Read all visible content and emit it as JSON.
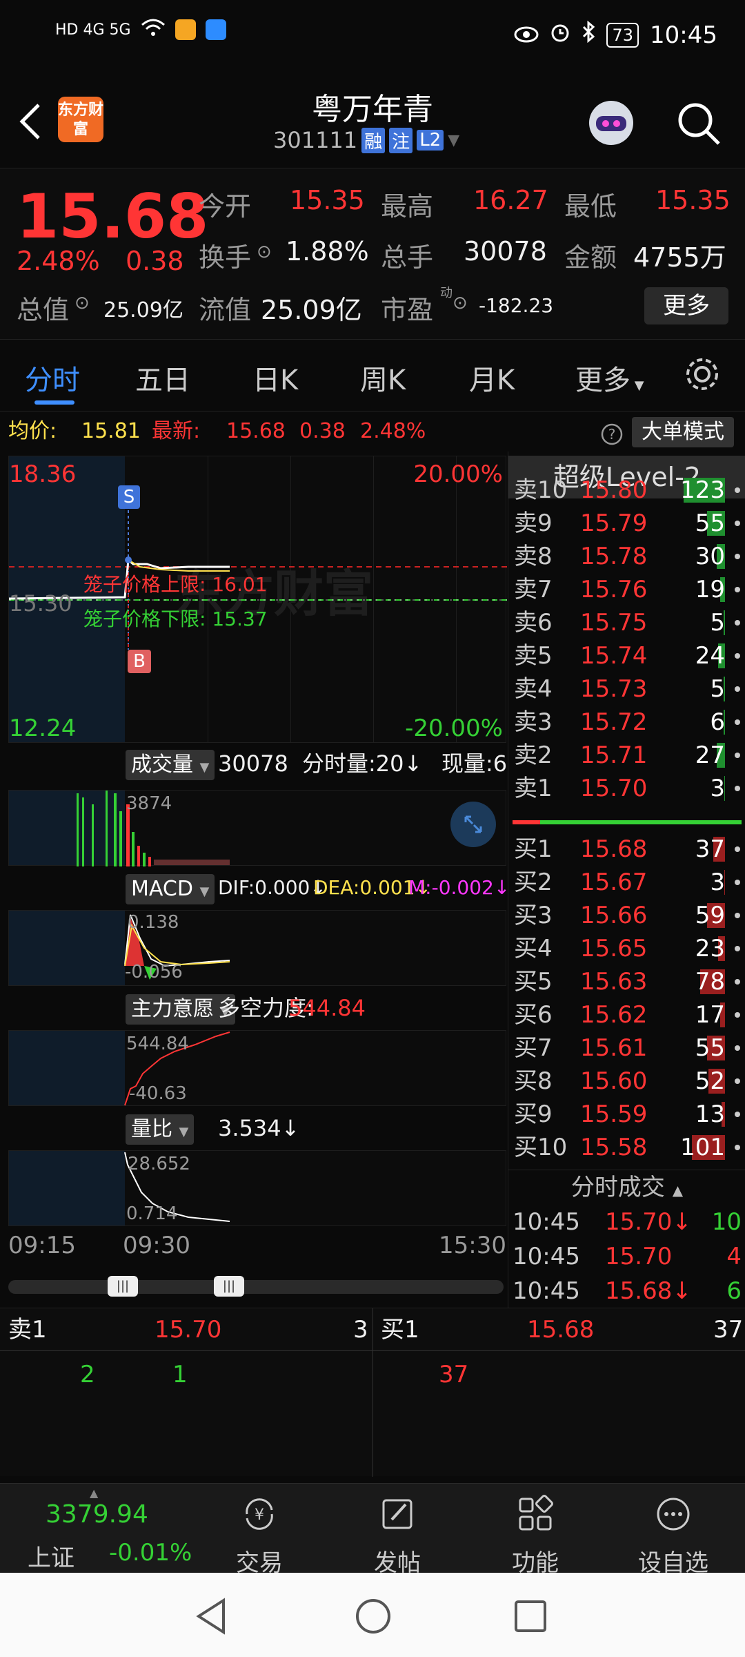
{
  "status_bar": {
    "network": "HD 4G 5G",
    "battery": "73",
    "time": "10:45"
  },
  "header": {
    "logo_text": "东方财富",
    "title": "粤万年青",
    "code": "301111",
    "tags": [
      "融",
      "注",
      "L2"
    ]
  },
  "quote": {
    "price": "15.68",
    "change_pct": "2.48%",
    "change": "0.38",
    "open_label": "今开",
    "open": "15.35",
    "high_label": "最高",
    "high": "16.27",
    "low_label": "最低",
    "low": "15.35",
    "turnover_label": "换手",
    "turnover": "1.88%",
    "volume_label": "总手",
    "volume": "30078",
    "amount_label": "金额",
    "amount": "4755万",
    "total_value_label": "总值",
    "total_value": "25.09亿",
    "float_value_label": "流值",
    "float_value": "25.09亿",
    "pe_label": "市盈",
    "pe_sup": "动",
    "pe": "-182.23",
    "more": "更多"
  },
  "tabs": [
    "分时",
    "五日",
    "日K",
    "周K",
    "月K",
    "更多"
  ],
  "avg_bar": {
    "avg_label": "均价:",
    "avg": "15.81",
    "latest_label": "最新:",
    "latest": "15.68",
    "change": "0.38",
    "pct": "2.48%",
    "big_order_mode": "大单模式"
  },
  "main_chart": {
    "top_price": "18.36",
    "top_pct": "20.00%",
    "mid_price": "15.30",
    "bottom_price": "12.24",
    "bottom_pct": "-20.00%",
    "upper_cage_label": "笼子价格上限:",
    "upper_cage": "16.01",
    "lower_cage_label": "笼子价格下限:",
    "lower_cage": "15.37",
    "sell_marker": "S",
    "buy_marker": "B",
    "watermark": "东方财富"
  },
  "volume_panel": {
    "selector": "成交量",
    "total": "30078",
    "minute_label": "分时量:20↓",
    "now_label": "现量:6",
    "max_label": "3874"
  },
  "macd_panel": {
    "selector": "MACD",
    "dif": "DIF:0.000↓",
    "dea": "DEA:0.001↓",
    "m": "M:-0.002↓",
    "top": "0.138",
    "bottom": "-0.056"
  },
  "force_panel": {
    "selector": "主力意愿",
    "label": "多空力度:",
    "value": "544.84",
    "top": "544.84",
    "bottom": "-40.63"
  },
  "ratio_panel": {
    "selector": "量比",
    "value": "3.534↓",
    "top": "28.652",
    "bottom": "0.714"
  },
  "time_axis": [
    "09:15",
    "09:30",
    "15:30"
  ],
  "orderbook": {
    "title": "超级Level-2",
    "asks": [
      {
        "label": "卖10",
        "price": "15.80",
        "vol": "123",
        "bar": 0.5
      },
      {
        "label": "卖9",
        "price": "15.79",
        "vol": "55",
        "bar": 0.22
      },
      {
        "label": "卖8",
        "price": "15.78",
        "vol": "30",
        "bar": 0.1
      },
      {
        "label": "卖7",
        "price": "15.76",
        "vol": "19",
        "bar": 0.06
      },
      {
        "label": "卖6",
        "price": "15.75",
        "vol": "5",
        "bar": 0.02
      },
      {
        "label": "卖5",
        "price": "15.74",
        "vol": "24",
        "bar": 0.08
      },
      {
        "label": "卖4",
        "price": "15.73",
        "vol": "5",
        "bar": 0.02
      },
      {
        "label": "卖3",
        "price": "15.72",
        "vol": "6",
        "bar": 0.02
      },
      {
        "label": "卖2",
        "price": "15.71",
        "vol": "27",
        "bar": 0.1
      },
      {
        "label": "卖1",
        "price": "15.70",
        "vol": "3",
        "bar": 0.01
      }
    ],
    "bids": [
      {
        "label": "买1",
        "price": "15.68",
        "vol": "37",
        "bar": 0.14
      },
      {
        "label": "买2",
        "price": "15.67",
        "vol": "3",
        "bar": 0.01
      },
      {
        "label": "买3",
        "price": "15.66",
        "vol": "59",
        "bar": 0.22
      },
      {
        "label": "买4",
        "price": "15.65",
        "vol": "23",
        "bar": 0.08
      },
      {
        "label": "买5",
        "price": "15.63",
        "vol": "78",
        "bar": 0.3
      },
      {
        "label": "买6",
        "price": "15.62",
        "vol": "17",
        "bar": 0.06
      },
      {
        "label": "买7",
        "price": "15.61",
        "vol": "55",
        "bar": 0.22
      },
      {
        "label": "买8",
        "price": "15.60",
        "vol": "52",
        "bar": 0.2
      },
      {
        "label": "买9",
        "price": "15.59",
        "vol": "13",
        "bar": 0.04
      },
      {
        "label": "买10",
        "price": "15.58",
        "vol": "101",
        "bar": 0.4
      }
    ],
    "trades_title": "分时成交",
    "trades": [
      {
        "time": "10:45",
        "price": "15.70↓",
        "vol": "10"
      },
      {
        "time": "10:45",
        "price": "15.70",
        "vol": "4"
      },
      {
        "time": "10:45",
        "price": "15.68↓",
        "vol": "6"
      }
    ]
  },
  "mini_depth": {
    "sell_label": "卖1",
    "sell_price": "15.70",
    "sell_vol": "3",
    "buy_label": "买1",
    "buy_price": "15.68",
    "buy_vol": "37",
    "sell_orders": [
      "2",
      "1"
    ],
    "buy_orders": [
      "37"
    ]
  },
  "bottom_nav": {
    "index_value": "3379.94",
    "index_name": "上证",
    "index_pct": "-0.01%",
    "items": [
      "交易",
      "发帖",
      "功能",
      "设自选"
    ]
  },
  "colors": {
    "up": "#ff3535",
    "down": "#35d135",
    "accent": "#3f8fff",
    "brand": "#f06a24"
  }
}
